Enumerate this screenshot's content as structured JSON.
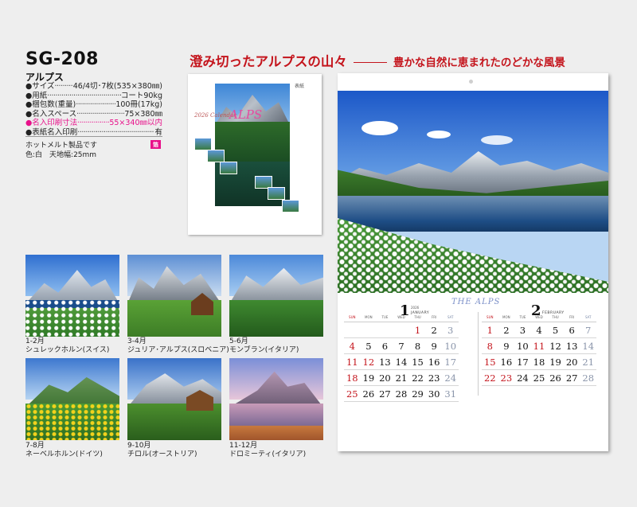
{
  "product": {
    "code": "SG-208",
    "name": "アルプス",
    "specs": [
      {
        "label": "●サイズ",
        "dots": true,
        "value": "46/4切･7枚(535×380㎜)",
        "accent": false
      },
      {
        "label": "●用紙",
        "dots": true,
        "value": "コート90kg",
        "accent": false
      },
      {
        "label": "●梱包数(重量)",
        "dots": true,
        "value": "100冊(17kg)",
        "accent": false
      },
      {
        "label": "●名入スペース",
        "dots": true,
        "value": "75×380㎜",
        "accent": false
      },
      {
        "label": "●名入印刷寸法",
        "dots": true,
        "value": "55×340㎜以内",
        "accent": true
      },
      {
        "label": "●表紙名入印刷",
        "dots": true,
        "value": "有",
        "accent": false
      }
    ],
    "note_line1": "ホットメルト製品です",
    "note_line2": "色:白　天地幅:25mm",
    "badge": "箔",
    "accent_color": "#e8108a"
  },
  "tagline": {
    "main": "澄み切ったアルプスの山々",
    "sub": "豊かな自然に恵まれたのどかな風景",
    "color": "#c4141c"
  },
  "cover": {
    "brand": "ALPS",
    "small_tag": "2026 Calendar",
    "corner": "表紙"
  },
  "months": [
    {
      "period": "1-2月",
      "place": "シュレックホルン(スイス)"
    },
    {
      "period": "3-4月",
      "place": "ジュリア･アルプス(スロベニア)"
    },
    {
      "period": "5-6月",
      "place": "モンブラン(イタリア)"
    },
    {
      "period": "7-8月",
      "place": "ネーベルホルン(ドイツ)"
    },
    {
      "period": "9-10月",
      "place": "チロル(オーストリア)"
    },
    {
      "period": "11-12月",
      "place": "ドロミーティ(イタリア)"
    }
  ],
  "calendar": {
    "logo": "THE ALPS",
    "weekdays": [
      "SUN",
      "MON",
      "TUE",
      "WED",
      "THU",
      "FRI",
      "SAT"
    ],
    "month1": {
      "number": "1",
      "english": "JANUARY",
      "year": "2026",
      "rows": [
        [
          "",
          "",
          "",
          "",
          "1",
          "2",
          "3"
        ],
        [
          "4",
          "5",
          "6",
          "7",
          "8",
          "9",
          "10"
        ],
        [
          "11",
          "12",
          "13",
          "14",
          "15",
          "16",
          "17"
        ],
        [
          "18",
          "19",
          "20",
          "21",
          "22",
          "23",
          "24"
        ],
        [
          "25",
          "26",
          "27",
          "28",
          "29",
          "30",
          "31"
        ]
      ],
      "holidays": [
        "1",
        "12"
      ]
    },
    "month2": {
      "number": "2",
      "english": "FEBRUARY",
      "rows": [
        [
          "1",
          "2",
          "3",
          "4",
          "5",
          "6",
          "7"
        ],
        [
          "8",
          "9",
          "10",
          "11",
          "12",
          "13",
          "14"
        ],
        [
          "15",
          "16",
          "17",
          "18",
          "19",
          "20",
          "21"
        ],
        [
          "22",
          "23",
          "24",
          "25",
          "26",
          "27",
          "28"
        ]
      ],
      "holidays": [
        "11",
        "23"
      ]
    }
  }
}
